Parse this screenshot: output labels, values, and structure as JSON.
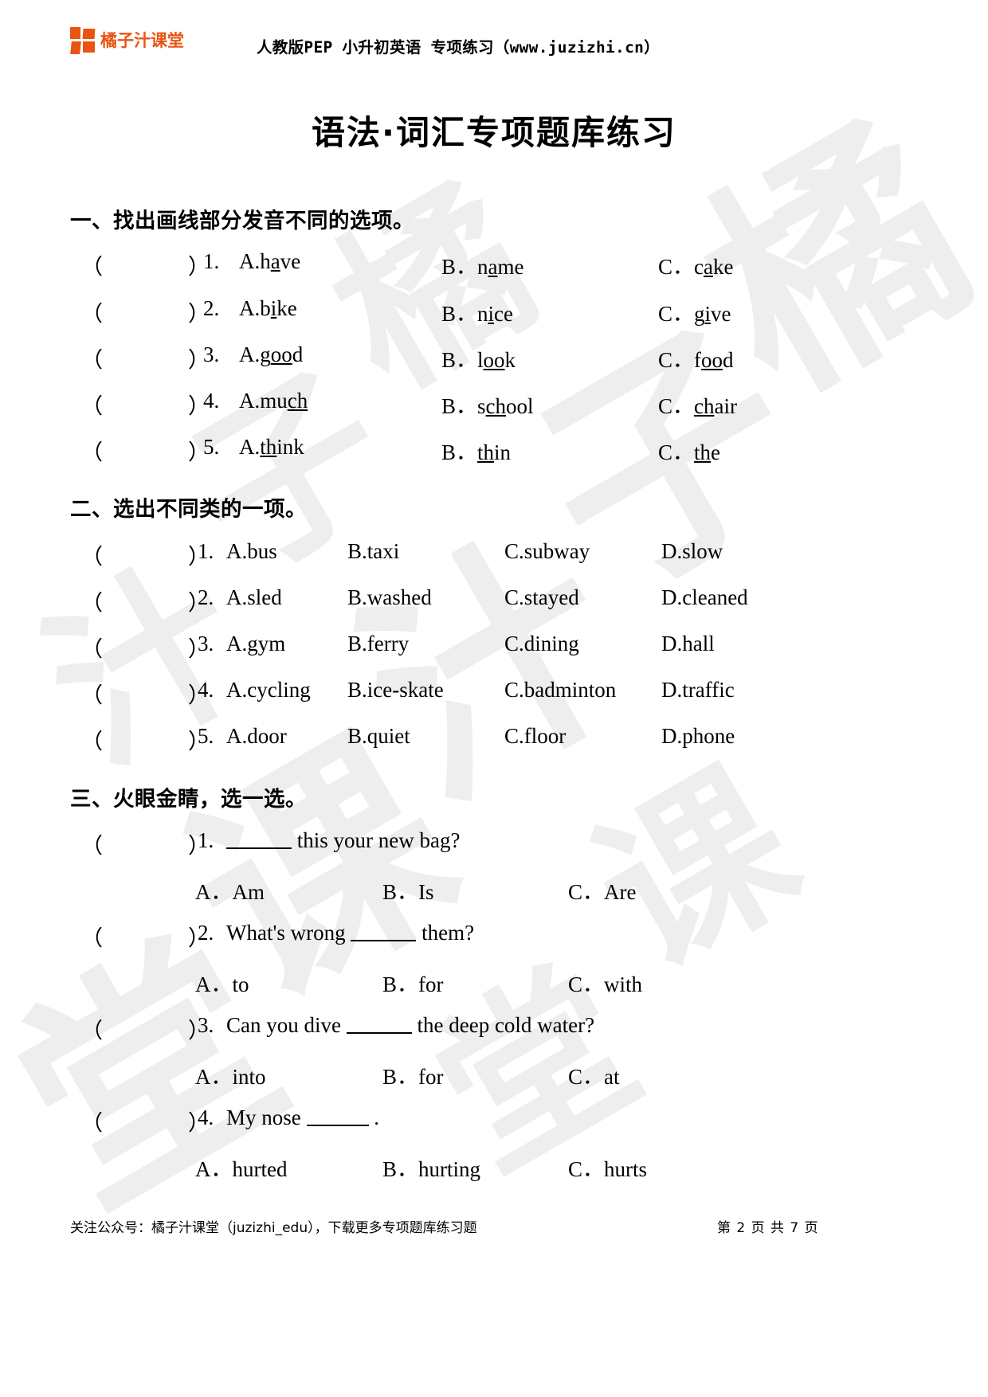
{
  "header": {
    "brand_name": "橘子汁课堂",
    "brand_color": "#ea5413",
    "title": "人教版PEP 小升初英语 专项练习（www.juzizhi.cn）"
  },
  "doc_title": "语法·词汇专项题库练习",
  "watermark_text": "橘子汁课堂",
  "sections": [
    {
      "heading": "一、找出画线部分发音不同的选项。",
      "questions": [
        {
          "num": "1.",
          "a_pre": "A.h",
          "a_mark": "a",
          "a_post": "ve",
          "b_label": "B．",
          "b_pre": "n",
          "b_mark": "a",
          "b_post": "me",
          "c_label": "C．",
          "c_pre": "c",
          "c_mark": "a",
          "c_post": "ke"
        },
        {
          "num": "2.",
          "a_pre": "A.b",
          "a_mark": "i",
          "a_post": "ke",
          "b_label": "B．",
          "b_pre": "n",
          "b_mark": "i",
          "b_post": "ce",
          "c_label": "C．",
          "c_pre": "g",
          "c_mark": "i",
          "c_post": "ve"
        },
        {
          "num": "3.",
          "a_pre": "A.g",
          "a_mark": "oo",
          "a_post": "d",
          "b_label": "B．",
          "b_pre": "l",
          "b_mark": "oo",
          "b_post": "k",
          "c_label": "C．",
          "c_pre": "f",
          "c_mark": "oo",
          "c_post": "d"
        },
        {
          "num": "4.",
          "a_pre": "A.mu",
          "a_mark": "ch",
          "a_post": "",
          "b_label": "B．",
          "b_pre": "s",
          "b_mark": "ch",
          "b_post": "ool",
          "c_label": "C．",
          "c_pre": "",
          "c_mark": "ch",
          "c_post": "air"
        },
        {
          "num": "5.",
          "a_pre": "A.",
          "a_mark": "th",
          "a_post": "ink",
          "b_label": "B．",
          "b_pre": "",
          "b_mark": "th",
          "b_post": "in",
          "c_label": "C．",
          "c_pre": "",
          "c_mark": "th",
          "c_post": "e"
        }
      ]
    },
    {
      "heading": "二、选出不同类的一项。",
      "questions": [
        {
          "num": "1.",
          "a": "A.bus",
          "b": "B.taxi",
          "c": "C.subway",
          "d": "D.slow"
        },
        {
          "num": "2.",
          "a": "A.sled",
          "b": "B.washed",
          "c": "C.stayed",
          "d": "D.cleaned"
        },
        {
          "num": "3.",
          "a": "A.gym",
          "b": "B.ferry",
          "c": "C.dining",
          "d": "D.hall"
        },
        {
          "num": "4.",
          "a": "A.cycling",
          "b": "B.ice-skate",
          "c": "C.badminton",
          "d": "D.traffic"
        },
        {
          "num": "5.",
          "a": "A.door",
          "b": "B.quiet",
          "c": "C.floor",
          "d": "D.phone"
        }
      ]
    },
    {
      "heading": "三、火眼金睛，选一选。",
      "questions": [
        {
          "num": "1.",
          "stem_pre": "",
          "stem_post": "this your new bag?",
          "a": "A．Am",
          "b": "B．Is",
          "c": "C．Are"
        },
        {
          "num": "2.",
          "stem_pre": "What's wrong",
          "stem_post": "them?",
          "a": "A．to",
          "b": "B．for",
          "c": "C．with"
        },
        {
          "num": "3.",
          "stem_pre": "Can you dive",
          "stem_post": "the deep cold water?",
          "a": "A．into",
          "b": "B．for",
          "c": "C．at"
        },
        {
          "num": "4.",
          "stem_pre": "My nose",
          "stem_post": ".",
          "a": "A．hurted",
          "b": "B．hurting",
          "c": "C．hurts"
        }
      ]
    }
  ],
  "paren_left": "（",
  "paren_right": "）",
  "footer": {
    "left": "关注公众号：橘子汁课堂（juzizhi_edu），下载更多专项题库练习题",
    "right": "第 2 页 共 7 页"
  }
}
